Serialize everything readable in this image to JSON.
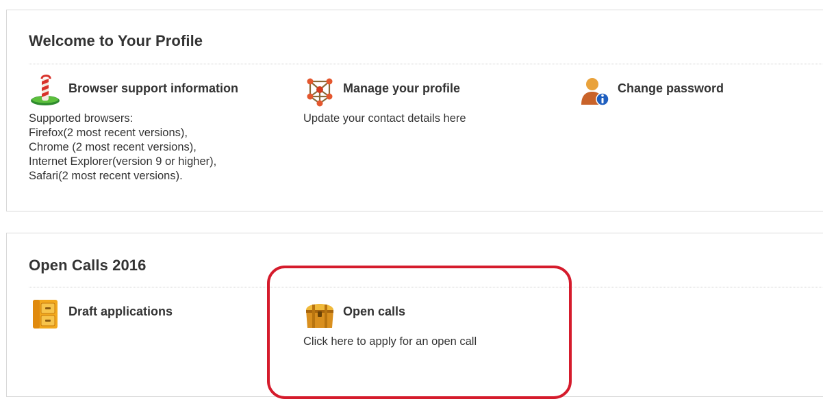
{
  "profile": {
    "title": "Welcome to Your Profile",
    "items": [
      {
        "icon": "candy-cane-icon",
        "title": "Browser support information",
        "desc": [
          "Supported browsers:",
          "Firefox(2 most recent versions),",
          "Chrome (2 most recent versions),",
          "Internet Explorer(version 9 or higher),",
          "Safari(2 most recent versions)."
        ]
      },
      {
        "icon": "molecule-icon",
        "title": "Manage your profile",
        "desc": [
          "Update your contact details here"
        ]
      },
      {
        "icon": "user-info-icon",
        "title": "Change password",
        "desc": []
      }
    ]
  },
  "calls": {
    "title": "Open Calls 2016",
    "items": [
      {
        "icon": "file-cabinet-icon",
        "title": "Draft applications",
        "desc": []
      },
      {
        "icon": "treasure-chest-icon",
        "title": "Open calls",
        "desc": [
          "Click here to apply for an open call"
        ]
      }
    ]
  },
  "colors": {
    "text": "#333333",
    "border": "#d9d9d9",
    "highlight": "#d51b2c"
  }
}
